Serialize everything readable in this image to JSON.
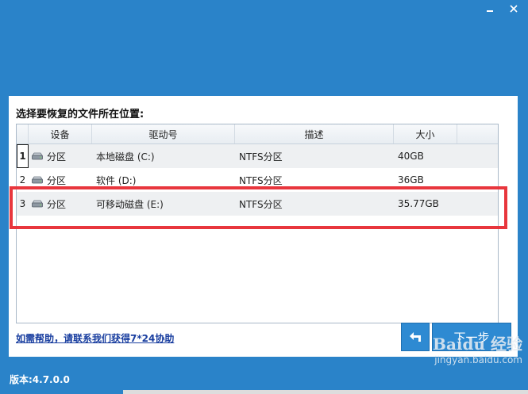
{
  "window": {
    "minimize_label": "−",
    "close_label": "✕"
  },
  "prompt": "选择要恢复的文件所在位置:",
  "table": {
    "headers": [
      "设备",
      "驱动号",
      "描述",
      "大小"
    ],
    "rows": [
      {
        "index": "1",
        "device": "分区",
        "drive": "本地磁盘 (C:)",
        "desc": "NTFS分区",
        "size": "40GB"
      },
      {
        "index": "2",
        "device": "分区",
        "drive": "软件 (D:)",
        "desc": "NTFS分区",
        "size": "36GB"
      },
      {
        "index": "3",
        "device": "分区",
        "drive": "可移动磁盘 (E:)",
        "desc": "NTFS分区",
        "size": "35.77GB"
      }
    ]
  },
  "help_link": "如需帮助，请联系我们获得7*24协助",
  "buttons": {
    "next": "下一步",
    "back_icon": "back-arrow-icon"
  },
  "version": "版本:4.7.0.0",
  "watermark": {
    "brand": "Baidu 经验",
    "url": "jingyan.baidu.com"
  },
  "colors": {
    "background": "#2a83c9",
    "highlight": "#e8363d",
    "button": "#2e8ad2"
  }
}
